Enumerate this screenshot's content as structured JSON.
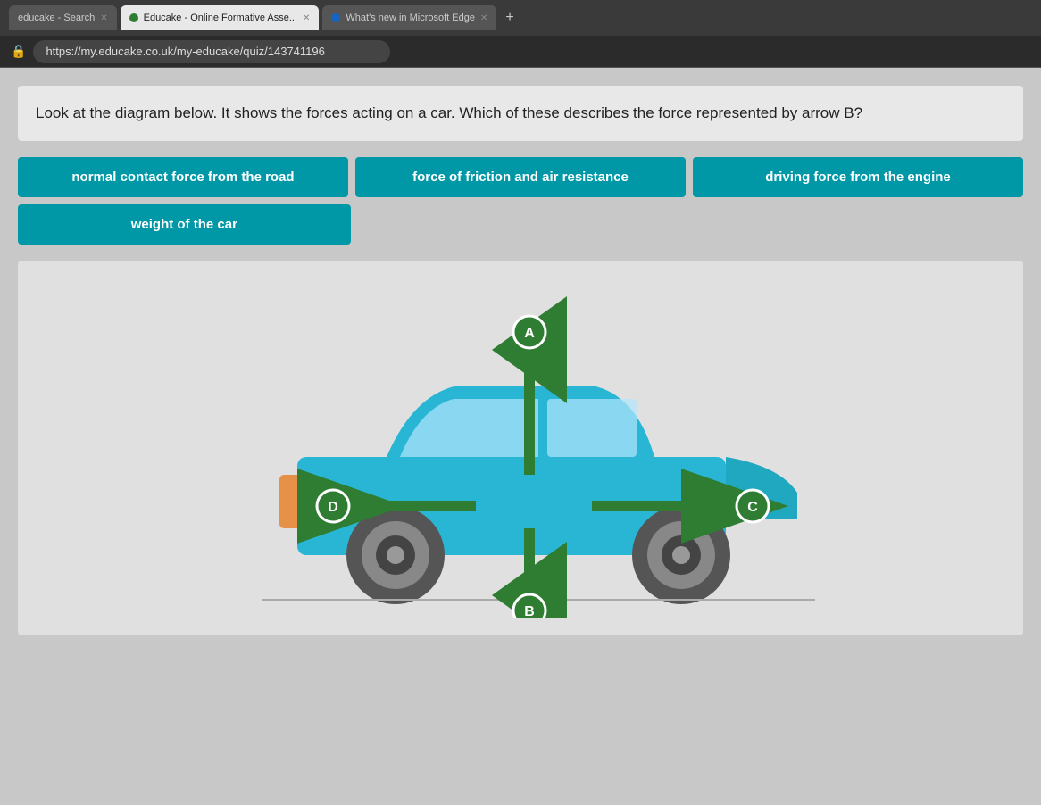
{
  "browser": {
    "tabs": [
      {
        "label": "educake - Search",
        "active": false,
        "id": "tab1"
      },
      {
        "label": "Educake - Online Formative Asse...",
        "active": true,
        "id": "tab2"
      },
      {
        "label": "What's new in Microsoft Edge",
        "active": false,
        "id": "tab3"
      }
    ],
    "add_tab_label": "+",
    "url": "https://my.educake.co.uk/my-educake/quiz/143741196"
  },
  "question": {
    "text": "Look at the diagram below. It shows the forces acting on a car. Which of these describes the force represented by arrow B?"
  },
  "options": [
    {
      "id": "opt1",
      "label": "normal contact force from the road"
    },
    {
      "id": "opt2",
      "label": "force of friction and air resistance"
    },
    {
      "id": "opt3",
      "label": "driving force from the engine"
    },
    {
      "id": "opt4",
      "label": "weight of the car"
    }
  ],
  "diagram": {
    "arrows": [
      {
        "id": "A",
        "direction": "up",
        "label": "A"
      },
      {
        "id": "B",
        "direction": "down",
        "label": "B"
      },
      {
        "id": "C",
        "direction": "right",
        "label": "C"
      },
      {
        "id": "D",
        "direction": "left",
        "label": "D"
      }
    ]
  }
}
